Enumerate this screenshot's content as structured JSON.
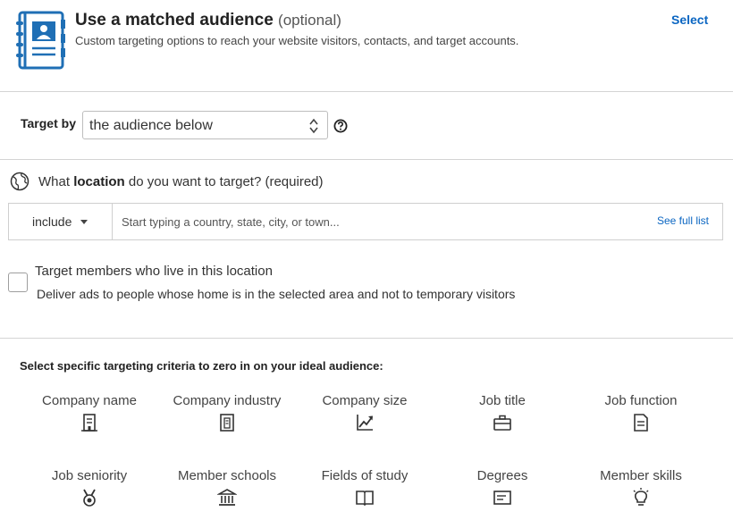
{
  "matched_audience": {
    "title": "Use a matched audience",
    "optional": "(optional)",
    "subtitle": "Custom targeting options to reach your website visitors, contacts, and target accounts.",
    "select_label": "Select",
    "icon": "contact-book-icon",
    "accent": "#1f6fb5"
  },
  "target_by": {
    "label": "Target by",
    "selected": "the audience below",
    "help_icon": "question-icon"
  },
  "location": {
    "question_prefix": "What ",
    "question_bold": "location",
    "question_suffix": " do you want to target? (required)",
    "include_label": "include",
    "placeholder": "Start typing a country, state, city, or town...",
    "full_list_label": "See full list",
    "checkbox_label": "Target members who live in this location",
    "checkbox_sub": "Deliver ads to people whose home is in the selected area and not to temporary visitors",
    "checkbox_checked": false
  },
  "criteria": {
    "heading": "Select specific targeting criteria to zero in on your ideal audience:",
    "items": [
      {
        "label": "Company name",
        "icon": "building-icon"
      },
      {
        "label": "Company industry",
        "icon": "document-building-icon"
      },
      {
        "label": "Company size",
        "icon": "growth-chart-icon"
      },
      {
        "label": "Job title",
        "icon": "briefcase-icon"
      },
      {
        "label": "Job function",
        "icon": "document-icon"
      },
      {
        "label": "Job seniority",
        "icon": "medal-icon"
      },
      {
        "label": "Member schools",
        "icon": "school-icon"
      },
      {
        "label": "Fields of study",
        "icon": "open-book-icon"
      },
      {
        "label": "Degrees",
        "icon": "certificate-icon"
      },
      {
        "label": "Member skills",
        "icon": "lightbulb-icon"
      }
    ]
  },
  "colors": {
    "link": "#0b66c2",
    "divider": "#d4d4d4",
    "text": "#333333"
  }
}
